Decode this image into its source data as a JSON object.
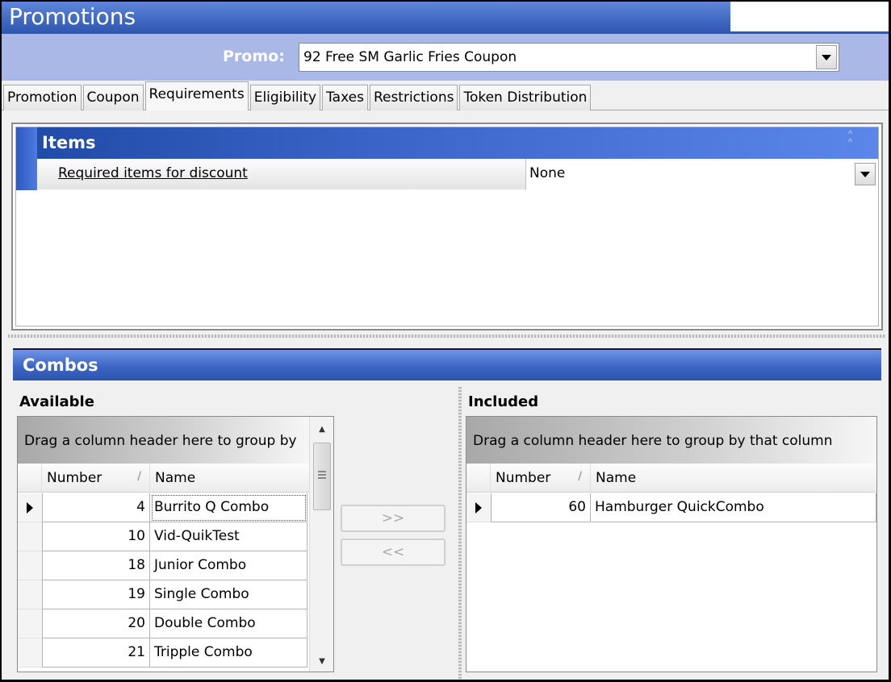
{
  "window": {
    "title": "Promotions"
  },
  "promo": {
    "label": "Promo:",
    "selected": "92 Free SM Garlic Fries Coupon"
  },
  "tabs": [
    {
      "label": "Promotion",
      "active": false
    },
    {
      "label": "Coupon",
      "active": false
    },
    {
      "label": "Requirements",
      "active": true
    },
    {
      "label": "Eligibility",
      "active": false
    },
    {
      "label": "Taxes",
      "active": false
    },
    {
      "label": "Restrictions",
      "active": false
    },
    {
      "label": "Token Distribution",
      "active": false
    }
  ],
  "items_section": {
    "title": "Items",
    "collapse_icon": "double-chevron-up-icon",
    "property": {
      "name": "Required items for discount",
      "value": "None"
    }
  },
  "combos_section": {
    "title": "Combos",
    "move_right_label": ">>",
    "move_left_label": "<<",
    "available": {
      "label": "Available",
      "group_hint": "Drag a column header here to group by",
      "columns": {
        "number": "Number",
        "name": "Name",
        "sort_indicator": "/"
      },
      "rows": [
        {
          "number": "4",
          "name": "Burrito Q Combo",
          "current": true
        },
        {
          "number": "10",
          "name": "Vid-QuikTest",
          "current": false
        },
        {
          "number": "18",
          "name": "Junior Combo",
          "current": false
        },
        {
          "number": "19",
          "name": "Single Combo",
          "current": false
        },
        {
          "number": "20",
          "name": "Double Combo",
          "current": false
        },
        {
          "number": "21",
          "name": "Tripple Combo",
          "current": false
        }
      ]
    },
    "included": {
      "label": "Included",
      "group_hint": "Drag a column header here to group by that column",
      "columns": {
        "number": "Number",
        "name": "Name",
        "sort_indicator": "/"
      },
      "rows": [
        {
          "number": "60",
          "name": "Hamburger QuickCombo",
          "current": true
        }
      ]
    }
  }
}
